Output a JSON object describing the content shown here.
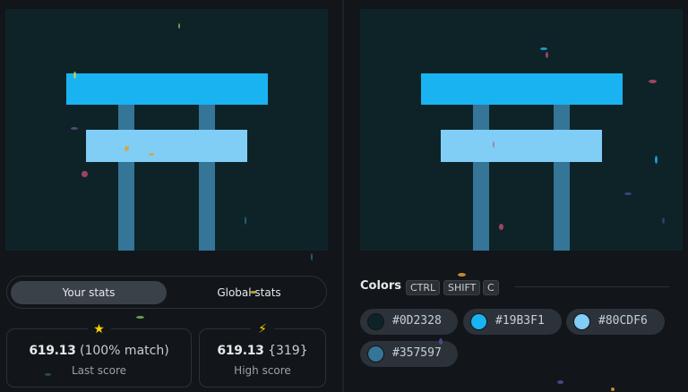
{
  "stats": {
    "tabs": [
      {
        "label": "Your stats",
        "active": true
      },
      {
        "label": "Global stats",
        "active": false
      }
    ],
    "last": {
      "score": "619.13",
      "extra": "(100% match)",
      "label": "Last score",
      "icon": "star-icon",
      "icon_color": "#f5d400"
    },
    "high": {
      "score": "619.13",
      "extra": "{319}",
      "label": "High score",
      "icon": "lightning-icon",
      "icon_color": "#f5d400"
    }
  },
  "colors": {
    "title": "Colors",
    "shortcut": [
      "CTRL",
      "SHIFT",
      "C"
    ],
    "palette": [
      {
        "hex": "#0D2328",
        "label": "#0D2328"
      },
      {
        "hex": "#19B3F1",
        "label": "#19B3F1"
      },
      {
        "hex": "#80CDF6",
        "label": "#80CDF6"
      },
      {
        "hex": "#357597",
        "label": "#357597"
      }
    ]
  },
  "canvas": {
    "background": "#0D2328",
    "pillar_color": "#357597",
    "top_bar_color": "#19B3F1",
    "mid_bar_color": "#80CDF6"
  }
}
